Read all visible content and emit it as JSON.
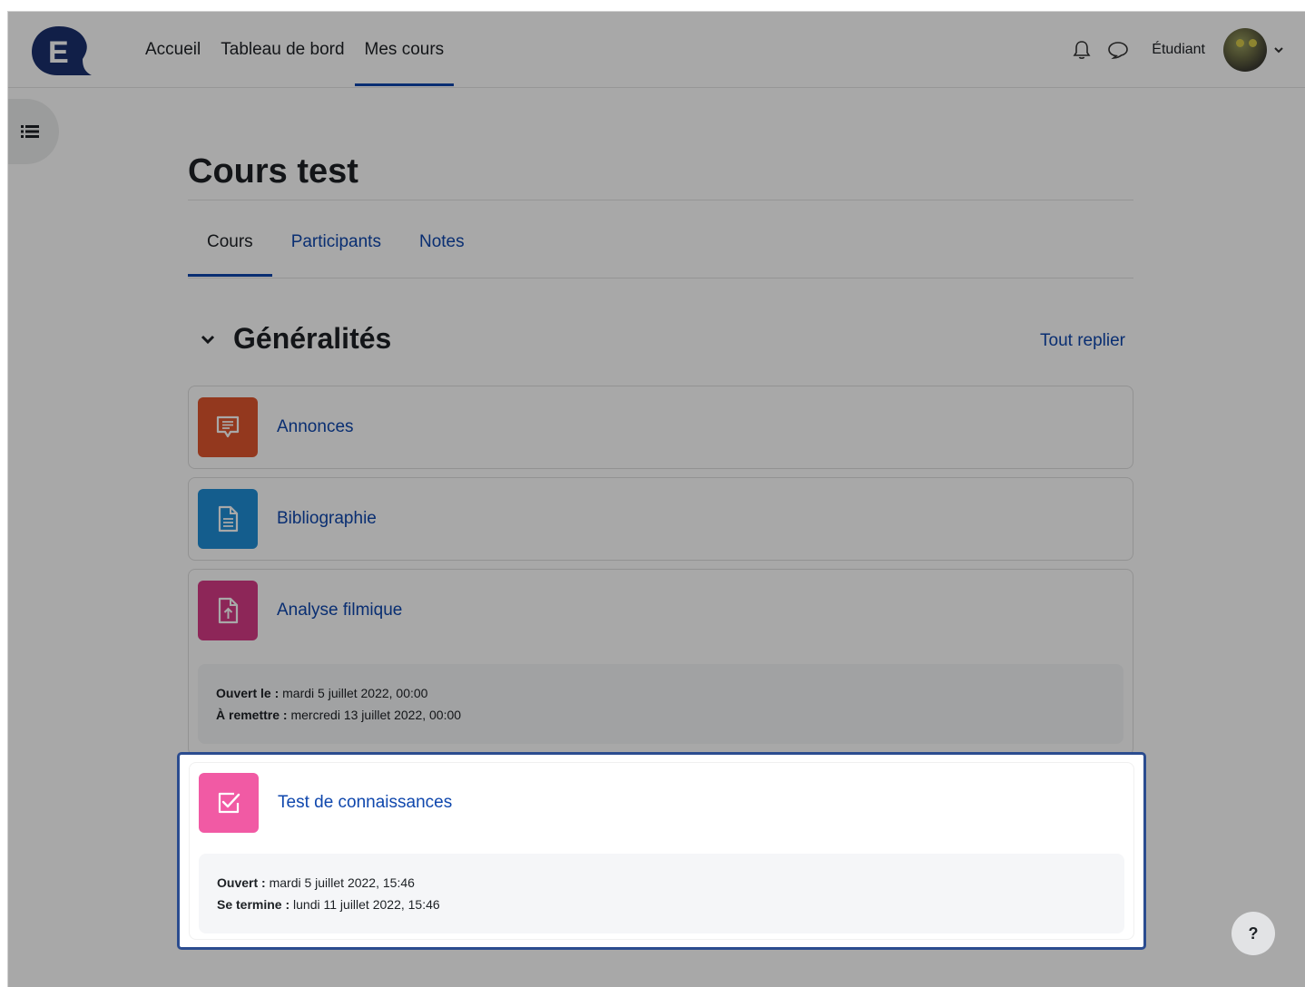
{
  "navbar": {
    "logo_letter": "E",
    "links": [
      {
        "label": "Accueil"
      },
      {
        "label": "Tableau de bord"
      },
      {
        "label": "Mes cours"
      }
    ],
    "user_name": "Étudiant"
  },
  "course": {
    "title": "Cours test",
    "tabs": [
      {
        "label": "Cours"
      },
      {
        "label": "Participants"
      },
      {
        "label": "Notes"
      }
    ]
  },
  "section": {
    "title": "Généralités",
    "collapse_all": "Tout replier"
  },
  "activities": [
    {
      "name": "Annonces",
      "icon": "forum-icon",
      "color": "#e0562e"
    },
    {
      "name": "Bibliographie",
      "icon": "file-icon",
      "color": "#1f8dd6"
    },
    {
      "name": "Analyse filmique",
      "icon": "assignment-upload-icon",
      "color": "#d63b86",
      "dates": {
        "open_label": "Ouvert le :",
        "open_value": "mardi 5 juillet 2022, 00:00",
        "due_label": "À remettre :",
        "due_value": "mercredi 13 juillet 2022, 00:00"
      }
    },
    {
      "name": "Test de connaissances",
      "icon": "quiz-icon",
      "color": "#f15aa4",
      "dates": {
        "open_label": "Ouvert :",
        "open_value": "mardi 5 juillet 2022, 15:46",
        "due_label": "Se termine :",
        "due_value": "lundi 11 juillet 2022, 15:46"
      }
    }
  ],
  "help_label": "?",
  "colors": {
    "accent": "#0f47ad",
    "highlight_border": "#2b4c8f"
  }
}
